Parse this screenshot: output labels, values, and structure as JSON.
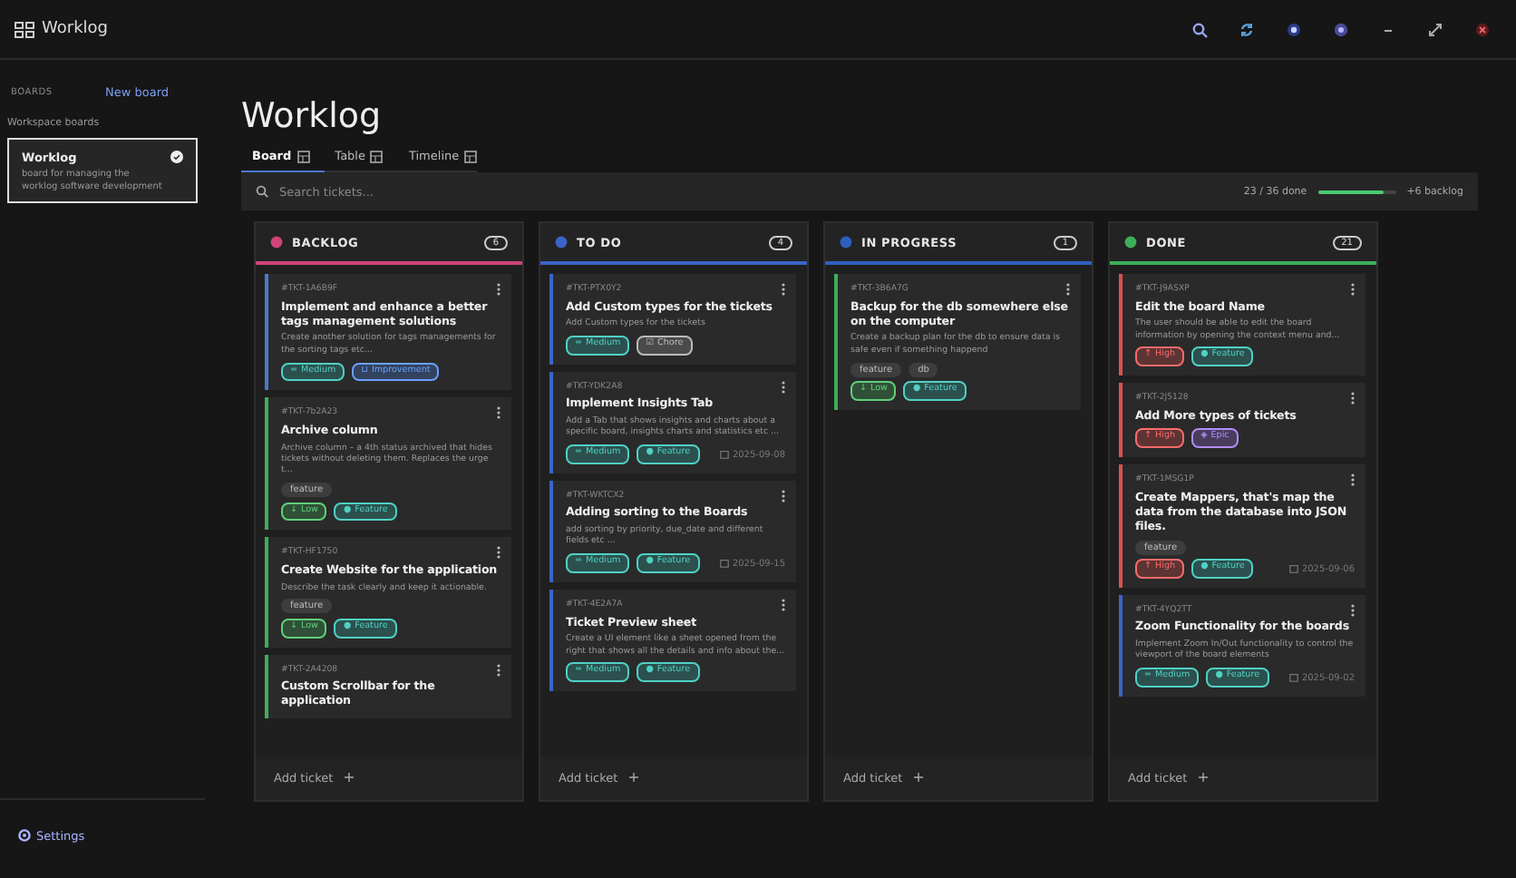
{
  "window": {
    "title": "Worklog"
  },
  "sidebar": {
    "section": "BOARDS",
    "new_board": "New board",
    "group": "Workspace boards",
    "boards": [
      {
        "name": "Worklog",
        "description": "board for managing the worklog software development",
        "selected": true
      }
    ],
    "settings": "Settings"
  },
  "main": {
    "title": "Worklog",
    "tabs": [
      {
        "label": "Board",
        "selected": true
      },
      {
        "label": "Table",
        "selected": false
      },
      {
        "label": "Timeline",
        "selected": false
      }
    ],
    "search": {
      "placeholder": "Search tickets..."
    },
    "progress": {
      "reading": "23 / 36 done",
      "level": 0.85,
      "backlog": "+6 backlog"
    }
  },
  "columns": [
    {
      "name": "BACKLOG",
      "count": "6",
      "color": "#d0447a",
      "cards": [
        {
          "id": "#TKT-1A6B9F",
          "title": "Implement and enhance a better tags management solutions",
          "description": "Create another solution for tags managements for the sorting tags etc...",
          "color": "#4a78d0",
          "chips": [
            {
              "icon": "=",
              "label": "Medium",
              "color": "#4fd1c5"
            },
            {
              "icon": "⊔",
              "label": "Improvement",
              "color": "#6aa0ff"
            }
          ]
        },
        {
          "id": "#TKT-7b2A23",
          "title": "Archive column",
          "description": "Archive column – a 4th status archived that hides tickets without deleting them. Replaces the urge t...",
          "color": "#3fae5a",
          "tags": [
            "feature"
          ],
          "chips": [
            {
              "icon": "↓",
              "label": "Low",
              "color": "#5fd07a"
            },
            {
              "icon": "●",
              "label": "Feature",
              "color": "#4fd1c5"
            }
          ]
        },
        {
          "id": "#TKT-HF1750",
          "title": "Create Website for the application",
          "description": "Describe the task clearly and keep it actionable.",
          "color": "#3fae5a",
          "tags": [
            "feature"
          ],
          "chips": [
            {
              "icon": "↓",
              "label": "Low",
              "color": "#5fd07a"
            },
            {
              "icon": "●",
              "label": "Feature",
              "color": "#4fd1c5"
            }
          ]
        },
        {
          "id": "#TKT-2A4208",
          "title": "Custom Scrollbar for the application",
          "color": "#3fae5a"
        }
      ]
    },
    {
      "name": "TO DO",
      "count": "4",
      "color": "#3a64c8",
      "cards": [
        {
          "id": "#TKT-PTX0Y2",
          "title": "Add Custom types for the tickets",
          "description": "Add Custom types for the tickets",
          "color": "#3a64c8",
          "chips": [
            {
              "icon": "=",
              "label": "Medium",
              "color": "#4fd1c5"
            },
            {
              "icon": "☑",
              "label": "Chore",
              "color": "#bbbbbb"
            }
          ]
        },
        {
          "id": "#TKT-YDK2A8",
          "title": "Implement Insights Tab",
          "description": "Add a Tab that shows insights and charts about a specific board, insights charts and statistics etc ...",
          "color": "#3a64c8",
          "chips": [
            {
              "icon": "=",
              "label": "Medium",
              "color": "#4fd1c5"
            },
            {
              "icon": "●",
              "label": "Feature",
              "color": "#4fd1c5"
            }
          ],
          "date": "2025-09-08"
        },
        {
          "id": "#TKT-WKTCX2",
          "title": "Adding sorting to the Boards",
          "description": "add sorting by priority, due_date and different fields etc ...",
          "color": "#3a64c8",
          "chips": [
            {
              "icon": "=",
              "label": "Medium",
              "color": "#4fd1c5"
            },
            {
              "icon": "●",
              "label": "Feature",
              "color": "#4fd1c5"
            }
          ],
          "date": "2025-09-15"
        },
        {
          "id": "#TKT-4E2A7A",
          "title": "Ticket Preview sheet",
          "description": "Create a UI element like a sheet opened from the right that shows all the details and info about the...",
          "color": "#3a64c8",
          "chips": [
            {
              "icon": "=",
              "label": "Medium",
              "color": "#4fd1c5"
            },
            {
              "icon": "●",
              "label": "Feature",
              "color": "#4fd1c5"
            }
          ]
        }
      ]
    },
    {
      "name": "IN PROGRESS",
      "count": "1",
      "color": "#2f5fc0",
      "cards": [
        {
          "id": "#TKT-3B6A7G",
          "title": "Backup for the db somewhere else on the computer",
          "description": "Create a backup plan for the db to ensure data is safe even if something happend",
          "color": "#3fae5a",
          "tags": [
            "feature",
            "db"
          ],
          "chips": [
            {
              "icon": "↓",
              "label": "Low",
              "color": "#5fd07a"
            },
            {
              "icon": "●",
              "label": "Feature",
              "color": "#4fd1c5"
            }
          ]
        }
      ]
    },
    {
      "name": "DONE",
      "count": "21",
      "color": "#3fae5a",
      "cards": [
        {
          "id": "#TKT-J9ASXP",
          "title": "Edit the board Name",
          "description": "The user should be able to edit the board information by opening the context menu and...",
          "color": "#d9534f",
          "chips": [
            {
              "icon": "↑",
              "label": "High",
              "color": "#ff6b6b"
            },
            {
              "icon": "●",
              "label": "Feature",
              "color": "#4fd1c5"
            }
          ]
        },
        {
          "id": "#TKT-2J5128",
          "title": "Add More types of tickets",
          "color": "#d9534f",
          "chips": [
            {
              "icon": "↑",
              "label": "High",
              "color": "#ff6b6b"
            },
            {
              "icon": "◈",
              "label": "Epic",
              "color": "#b38cff"
            }
          ]
        },
        {
          "id": "#TKT-1MSG1P",
          "title": "Create Mappers, that's map the data from the database into JSON files.",
          "color": "#d9534f",
          "tags": [
            "feature"
          ],
          "chips": [
            {
              "icon": "↑",
              "label": "High",
              "color": "#ff6b6b"
            },
            {
              "icon": "●",
              "label": "Feature",
              "color": "#4fd1c5"
            }
          ],
          "date": "2025-09-06"
        },
        {
          "id": "#TKT-4YQ2TT",
          "title": "Zoom Functionality for the boards",
          "description": "Implement Zoom In/Out functionality to control the viewport of the board elements",
          "color": "#3a64c8",
          "chips": [
            {
              "icon": "=",
              "label": "Medium",
              "color": "#4fd1c5"
            },
            {
              "icon": "●",
              "label": "Feature",
              "color": "#4fd1c5"
            }
          ],
          "date": "2025-09-02"
        }
      ]
    }
  ],
  "add_ticket": [
    "Add ticket",
    "Add ticket",
    "Add ticket",
    "Add ticket"
  ]
}
